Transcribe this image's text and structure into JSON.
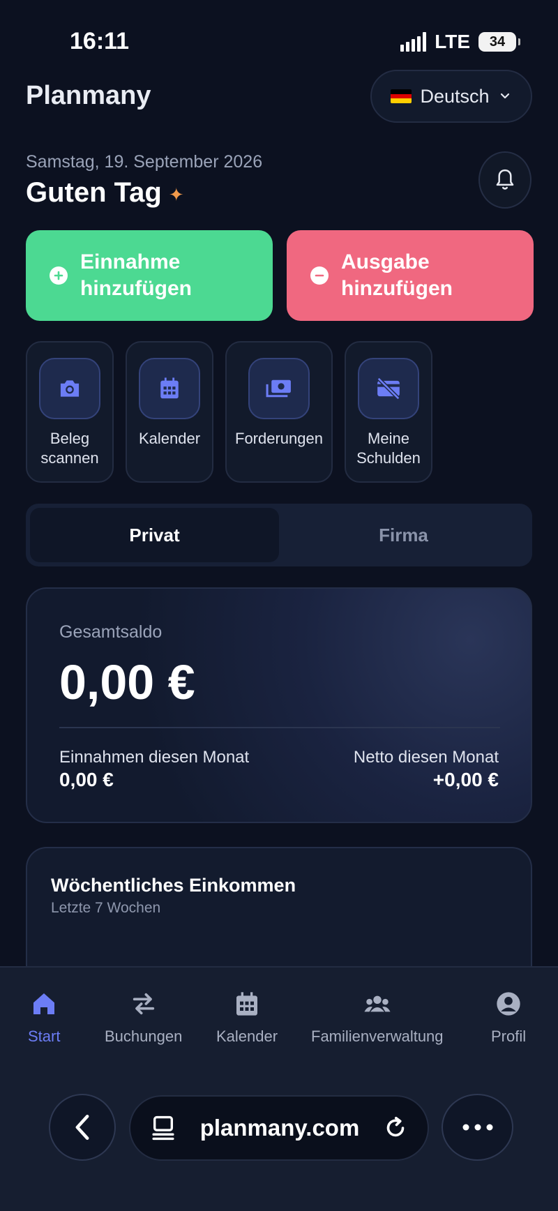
{
  "status": {
    "time": "16:11",
    "network": "LTE",
    "battery": "34"
  },
  "header": {
    "brand": "Planmany",
    "language": "Deutsch"
  },
  "greeting": {
    "date": "Samstag, 19. September 2026",
    "text": "Guten Tag",
    "sparkle": "✦"
  },
  "actions": {
    "income_label": "Einnahme hinzufügen",
    "expense_label": "Ausgabe hinzufügen"
  },
  "quick": [
    {
      "label": "Beleg scannen",
      "icon": "camera-icon"
    },
    {
      "label": "Kalender",
      "icon": "calendar-icon"
    },
    {
      "label": "Forderungen",
      "icon": "money-icon"
    },
    {
      "label": "Meine Schulden",
      "icon": "no-card-icon"
    }
  ],
  "segment": {
    "private": "Privat",
    "business": "Firma",
    "active": "Privat"
  },
  "balance": {
    "label": "Gesamtsaldo",
    "amount": "0,00 €",
    "income_label": "Einnahmen diesen Monat",
    "income_value": "0,00 €",
    "net_label": "Netto diesen Monat",
    "net_value": "+0,00 €"
  },
  "weekly": {
    "title": "Wöchentliches Einkommen",
    "subtitle": "Letzte 7 Wochen"
  },
  "nav": [
    {
      "label": "Start",
      "icon": "home-icon",
      "active": true
    },
    {
      "label": "Buchungen",
      "icon": "transfer-icon",
      "active": false
    },
    {
      "label": "Kalender",
      "icon": "calendar-icon",
      "active": false
    },
    {
      "label": "Familienverwaltung",
      "icon": "family-icon",
      "active": false
    },
    {
      "label": "Profil",
      "icon": "profile-icon",
      "active": false
    }
  ],
  "browser": {
    "url": "planmany.com"
  },
  "colors": {
    "income": "#4cd992",
    "expense": "#f06880",
    "accent": "#6c7df5",
    "background": "#0c1120"
  }
}
